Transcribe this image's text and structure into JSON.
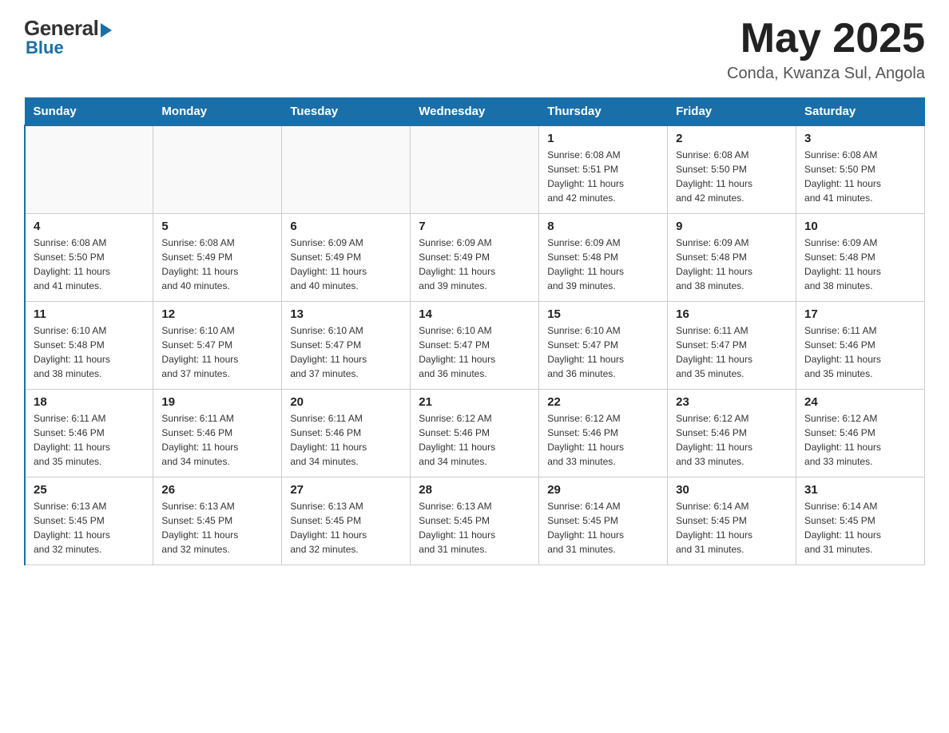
{
  "header": {
    "logo_general": "General",
    "logo_blue": "Blue",
    "month_year": "May 2025",
    "location": "Conda, Kwanza Sul, Angola"
  },
  "days_of_week": [
    "Sunday",
    "Monday",
    "Tuesday",
    "Wednesday",
    "Thursday",
    "Friday",
    "Saturday"
  ],
  "weeks": [
    [
      {
        "day": "",
        "info": ""
      },
      {
        "day": "",
        "info": ""
      },
      {
        "day": "",
        "info": ""
      },
      {
        "day": "",
        "info": ""
      },
      {
        "day": "1",
        "info": "Sunrise: 6:08 AM\nSunset: 5:51 PM\nDaylight: 11 hours\nand 42 minutes."
      },
      {
        "day": "2",
        "info": "Sunrise: 6:08 AM\nSunset: 5:50 PM\nDaylight: 11 hours\nand 42 minutes."
      },
      {
        "day": "3",
        "info": "Sunrise: 6:08 AM\nSunset: 5:50 PM\nDaylight: 11 hours\nand 41 minutes."
      }
    ],
    [
      {
        "day": "4",
        "info": "Sunrise: 6:08 AM\nSunset: 5:50 PM\nDaylight: 11 hours\nand 41 minutes."
      },
      {
        "day": "5",
        "info": "Sunrise: 6:08 AM\nSunset: 5:49 PM\nDaylight: 11 hours\nand 40 minutes."
      },
      {
        "day": "6",
        "info": "Sunrise: 6:09 AM\nSunset: 5:49 PM\nDaylight: 11 hours\nand 40 minutes."
      },
      {
        "day": "7",
        "info": "Sunrise: 6:09 AM\nSunset: 5:49 PM\nDaylight: 11 hours\nand 39 minutes."
      },
      {
        "day": "8",
        "info": "Sunrise: 6:09 AM\nSunset: 5:48 PM\nDaylight: 11 hours\nand 39 minutes."
      },
      {
        "day": "9",
        "info": "Sunrise: 6:09 AM\nSunset: 5:48 PM\nDaylight: 11 hours\nand 38 minutes."
      },
      {
        "day": "10",
        "info": "Sunrise: 6:09 AM\nSunset: 5:48 PM\nDaylight: 11 hours\nand 38 minutes."
      }
    ],
    [
      {
        "day": "11",
        "info": "Sunrise: 6:10 AM\nSunset: 5:48 PM\nDaylight: 11 hours\nand 38 minutes."
      },
      {
        "day": "12",
        "info": "Sunrise: 6:10 AM\nSunset: 5:47 PM\nDaylight: 11 hours\nand 37 minutes."
      },
      {
        "day": "13",
        "info": "Sunrise: 6:10 AM\nSunset: 5:47 PM\nDaylight: 11 hours\nand 37 minutes."
      },
      {
        "day": "14",
        "info": "Sunrise: 6:10 AM\nSunset: 5:47 PM\nDaylight: 11 hours\nand 36 minutes."
      },
      {
        "day": "15",
        "info": "Sunrise: 6:10 AM\nSunset: 5:47 PM\nDaylight: 11 hours\nand 36 minutes."
      },
      {
        "day": "16",
        "info": "Sunrise: 6:11 AM\nSunset: 5:47 PM\nDaylight: 11 hours\nand 35 minutes."
      },
      {
        "day": "17",
        "info": "Sunrise: 6:11 AM\nSunset: 5:46 PM\nDaylight: 11 hours\nand 35 minutes."
      }
    ],
    [
      {
        "day": "18",
        "info": "Sunrise: 6:11 AM\nSunset: 5:46 PM\nDaylight: 11 hours\nand 35 minutes."
      },
      {
        "day": "19",
        "info": "Sunrise: 6:11 AM\nSunset: 5:46 PM\nDaylight: 11 hours\nand 34 minutes."
      },
      {
        "day": "20",
        "info": "Sunrise: 6:11 AM\nSunset: 5:46 PM\nDaylight: 11 hours\nand 34 minutes."
      },
      {
        "day": "21",
        "info": "Sunrise: 6:12 AM\nSunset: 5:46 PM\nDaylight: 11 hours\nand 34 minutes."
      },
      {
        "day": "22",
        "info": "Sunrise: 6:12 AM\nSunset: 5:46 PM\nDaylight: 11 hours\nand 33 minutes."
      },
      {
        "day": "23",
        "info": "Sunrise: 6:12 AM\nSunset: 5:46 PM\nDaylight: 11 hours\nand 33 minutes."
      },
      {
        "day": "24",
        "info": "Sunrise: 6:12 AM\nSunset: 5:46 PM\nDaylight: 11 hours\nand 33 minutes."
      }
    ],
    [
      {
        "day": "25",
        "info": "Sunrise: 6:13 AM\nSunset: 5:45 PM\nDaylight: 11 hours\nand 32 minutes."
      },
      {
        "day": "26",
        "info": "Sunrise: 6:13 AM\nSunset: 5:45 PM\nDaylight: 11 hours\nand 32 minutes."
      },
      {
        "day": "27",
        "info": "Sunrise: 6:13 AM\nSunset: 5:45 PM\nDaylight: 11 hours\nand 32 minutes."
      },
      {
        "day": "28",
        "info": "Sunrise: 6:13 AM\nSunset: 5:45 PM\nDaylight: 11 hours\nand 31 minutes."
      },
      {
        "day": "29",
        "info": "Sunrise: 6:14 AM\nSunset: 5:45 PM\nDaylight: 11 hours\nand 31 minutes."
      },
      {
        "day": "30",
        "info": "Sunrise: 6:14 AM\nSunset: 5:45 PM\nDaylight: 11 hours\nand 31 minutes."
      },
      {
        "day": "31",
        "info": "Sunrise: 6:14 AM\nSunset: 5:45 PM\nDaylight: 11 hours\nand 31 minutes."
      }
    ]
  ]
}
